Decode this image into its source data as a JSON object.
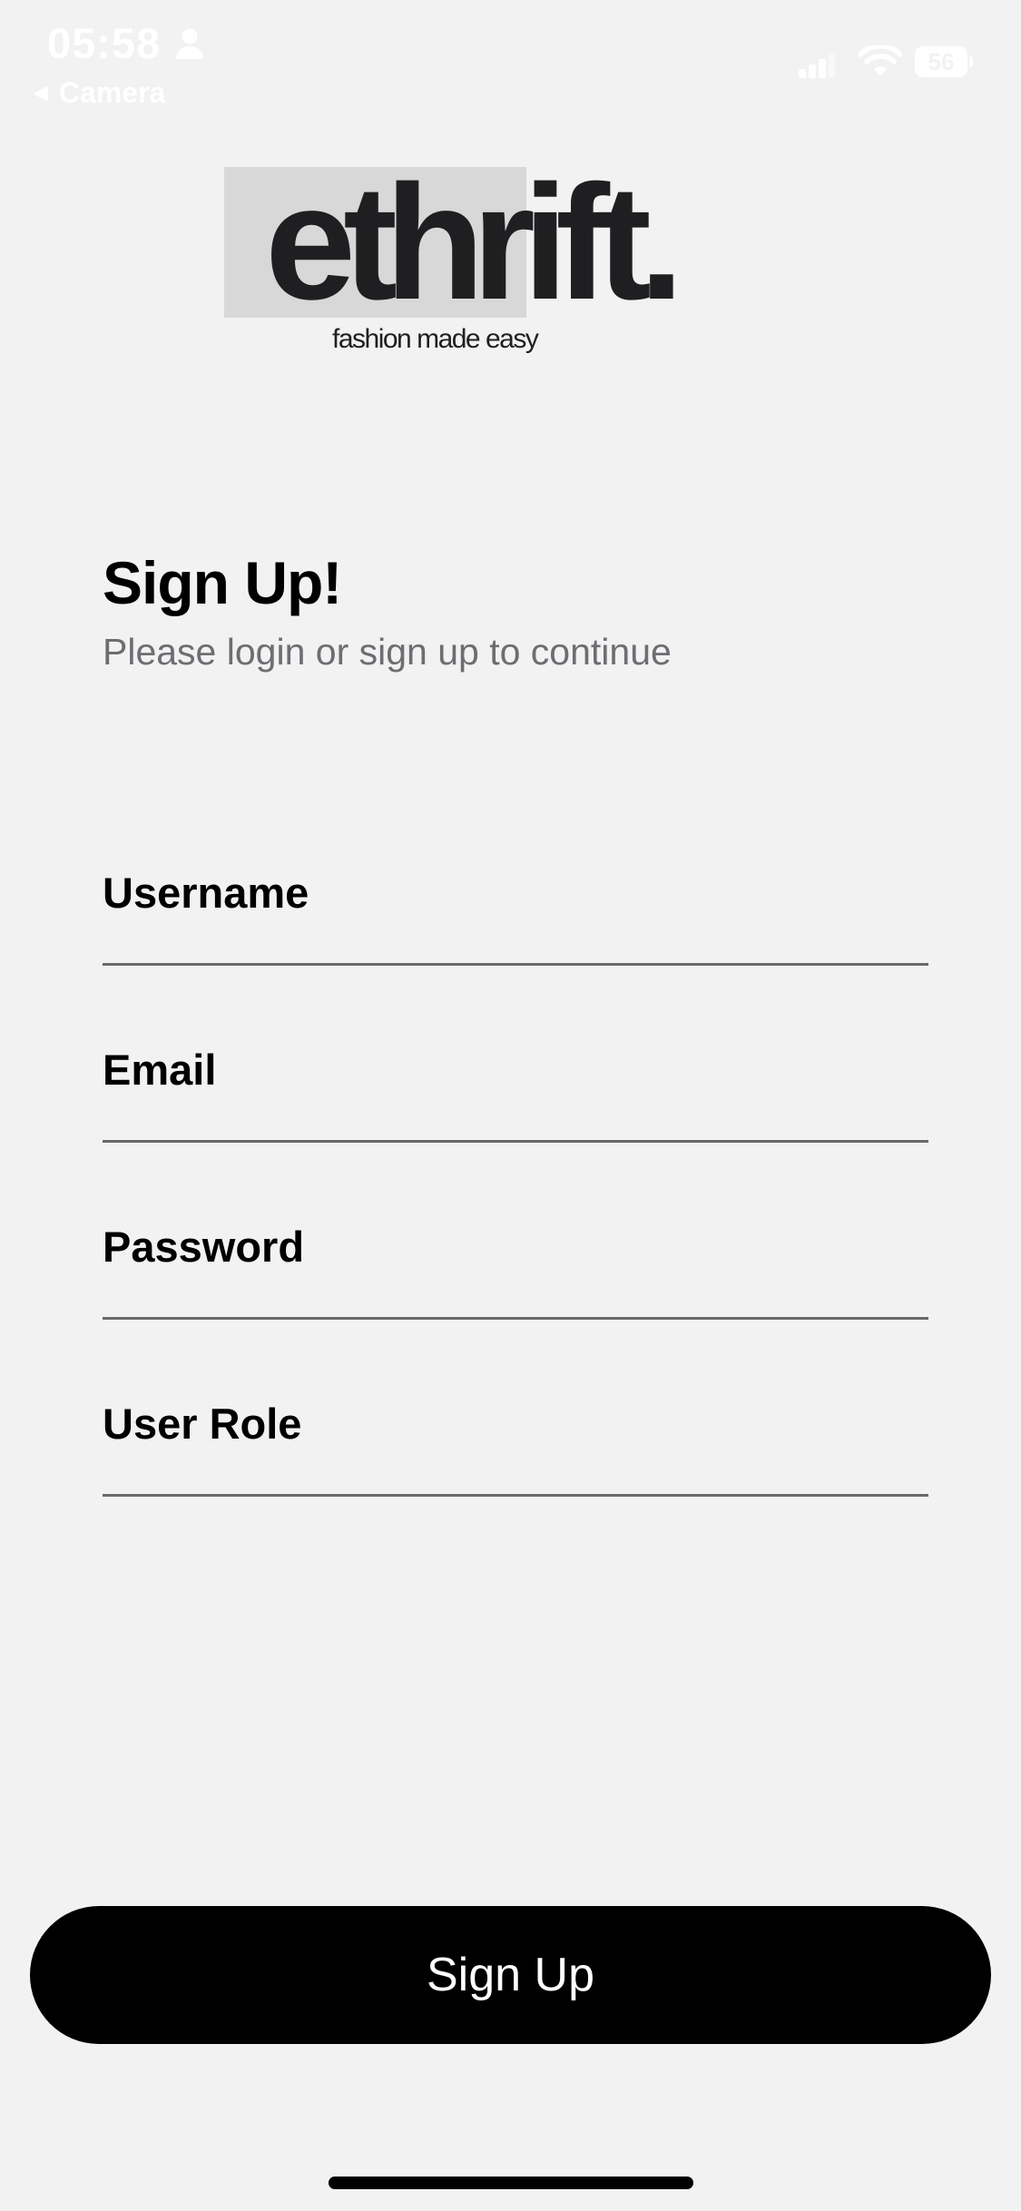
{
  "status_bar": {
    "time": "05:58",
    "back_label": "Camera",
    "battery_level": "56",
    "icons": [
      "person-icon",
      "back-arrow-icon",
      "signal-icon",
      "wifi-icon",
      "battery-icon"
    ]
  },
  "logo": {
    "wordmark": "ethrift.",
    "tagline": "fashion made easy"
  },
  "header": {
    "title": "Sign Up!",
    "subtitle": "Please login or sign up to continue"
  },
  "form": {
    "fields": [
      {
        "label": "Username",
        "value": ""
      },
      {
        "label": "Email",
        "value": ""
      },
      {
        "label": "Password",
        "value": ""
      },
      {
        "label": "User Role",
        "value": ""
      }
    ]
  },
  "actions": {
    "signup_label": "Sign Up"
  },
  "colors": {
    "background": "#f2f2f2",
    "primary_button": "#000000",
    "subtitle_text": "#6d6d72",
    "logo_highlight": "#d8d8d8"
  }
}
